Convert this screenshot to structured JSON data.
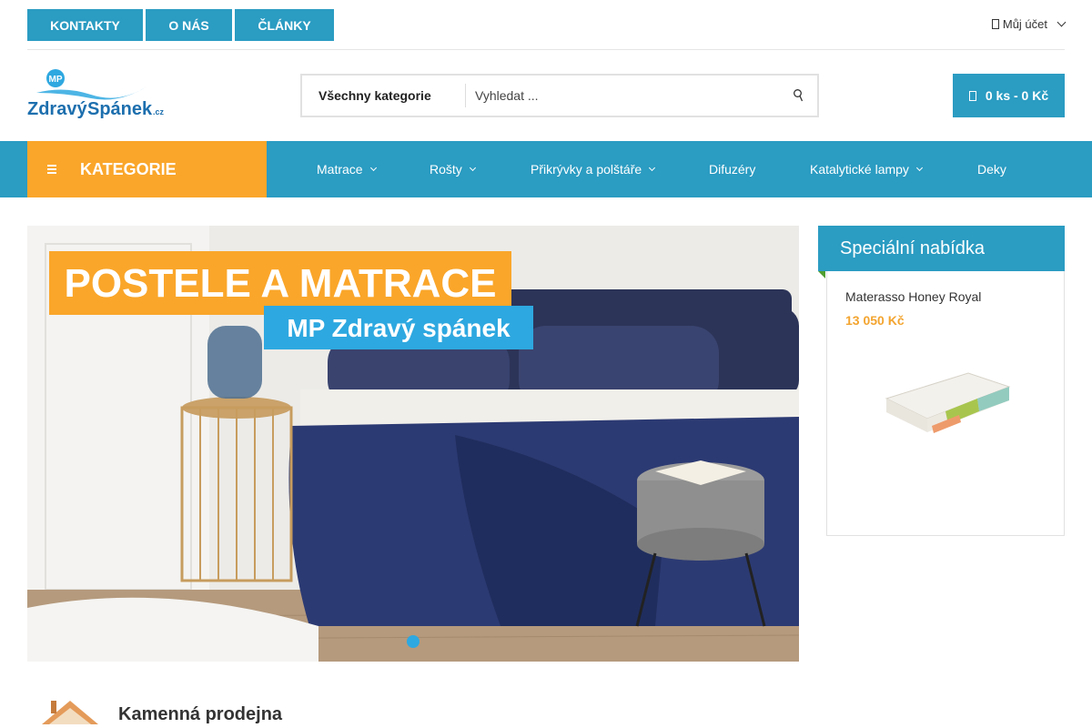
{
  "topbar": {
    "links": [
      "KONTAKTY",
      "O NÁS",
      "ČLÁNKY"
    ],
    "account_label": "Můj účet"
  },
  "logo": {
    "badge": "MP",
    "word1": "Zdravý",
    "word2": "Spánek",
    "tld": ".cz"
  },
  "search": {
    "category": "Všechny kategorie",
    "placeholder": "Vyhledat ..."
  },
  "cart": {
    "label": "0 ks - 0 Kč"
  },
  "nav": {
    "category_button": "KATEGORIE",
    "items": [
      {
        "label": "Matrace"
      },
      {
        "label": "Rošty"
      },
      {
        "label": "Přikrývky a polštáře"
      },
      {
        "label": "Difuzéry"
      },
      {
        "label": "Katalytické lampy"
      },
      {
        "label": "Deky"
      }
    ]
  },
  "banner": {
    "headline": "POSTELE A MATRACE",
    "subline": "MP Zdravý spánek"
  },
  "special": {
    "title": "Speciální nabídka",
    "product_name": "Materasso Honey Royal",
    "product_price": "13 050 Kč"
  },
  "store": {
    "title": "Kamenná prodejna"
  },
  "colors": {
    "primary": "#2b9cc2",
    "accent_orange": "#faa62a",
    "price": "#f3a42f"
  },
  "icons": [
    "user-icon",
    "search-icon",
    "cart-icon",
    "menu-icon",
    "chevron-down-icon",
    "house-icon"
  ]
}
